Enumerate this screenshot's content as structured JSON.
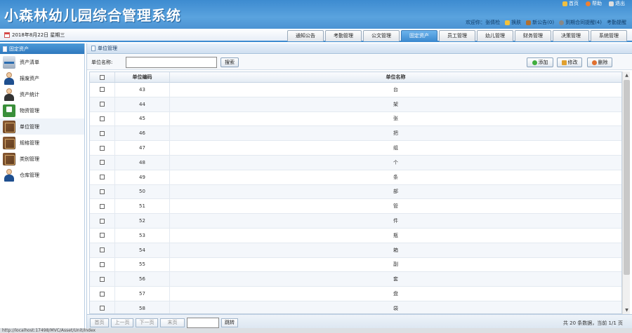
{
  "app": {
    "title": "小森林幼儿园综合管理系统"
  },
  "top_links": [
    {
      "label": "首页",
      "color": "#f0c040"
    },
    {
      "label": "帮助",
      "color": "#f08030"
    },
    {
      "label": "退出",
      "color": "#dddddd"
    }
  ],
  "userbar": {
    "welcome": "欢迎你：张倩检",
    "switch": "换肤",
    "notice": "新公告(0)",
    "reminder": "到期合同提醒(4)",
    "attendance": "考勤提醒"
  },
  "date": {
    "text": "2018年8月22日 星期三"
  },
  "tabs": [
    {
      "label": "通知公告",
      "active": false
    },
    {
      "label": "考勤管理",
      "active": false
    },
    {
      "label": "公文管理",
      "active": false
    },
    {
      "label": "固定资产",
      "active": true
    },
    {
      "label": "员工管理",
      "active": false
    },
    {
      "label": "幼儿管理",
      "active": false
    },
    {
      "label": "财务管理",
      "active": false
    },
    {
      "label": "决策管理",
      "active": false
    },
    {
      "label": "系统管理",
      "active": false
    }
  ],
  "sidebar": {
    "title": "固定资产",
    "items": [
      {
        "label": "资产清单",
        "icon": "scanner-icon"
      },
      {
        "label": "报废资产",
        "icon": "person-icon"
      },
      {
        "label": "资产统计",
        "icon": "person-icon"
      },
      {
        "label": "物资管理",
        "icon": "truck-icon"
      },
      {
        "label": "单位管理",
        "icon": "book-icon",
        "active": true
      },
      {
        "label": "规格管理",
        "icon": "book-icon"
      },
      {
        "label": "类别管理",
        "icon": "book-icon"
      },
      {
        "label": "仓库管理",
        "icon": "person-icon"
      }
    ]
  },
  "panel": {
    "title": "单位管理"
  },
  "search": {
    "label": "单位名称:",
    "value": "",
    "button": "搜索"
  },
  "actions": {
    "add": "添加",
    "edit": "修改",
    "delete": "删除"
  },
  "table": {
    "columns": [
      "单位编码",
      "单位名称"
    ],
    "rows": [
      {
        "code": "43",
        "name": "台"
      },
      {
        "code": "44",
        "name": "架"
      },
      {
        "code": "45",
        "name": "张"
      },
      {
        "code": "46",
        "name": "把"
      },
      {
        "code": "47",
        "name": "组"
      },
      {
        "code": "48",
        "name": "个"
      },
      {
        "code": "49",
        "name": "条"
      },
      {
        "code": "50",
        "name": "部"
      },
      {
        "code": "51",
        "name": "管"
      },
      {
        "code": "52",
        "name": "件"
      },
      {
        "code": "53",
        "name": "瓶"
      },
      {
        "code": "54",
        "name": "箱"
      },
      {
        "code": "55",
        "name": "副"
      },
      {
        "code": "56",
        "name": "套"
      },
      {
        "code": "57",
        "name": "盘"
      },
      {
        "code": "58",
        "name": "袋"
      }
    ]
  },
  "pager": {
    "first": "首页",
    "prev": "上一页",
    "next": "下一页",
    "last": "末页",
    "jump": "跳转",
    "summary": "共 20 条数据，当前 1/1 页"
  },
  "status": {
    "text": "http://localhost:17498/MVC/Asset/Unit/Index"
  }
}
